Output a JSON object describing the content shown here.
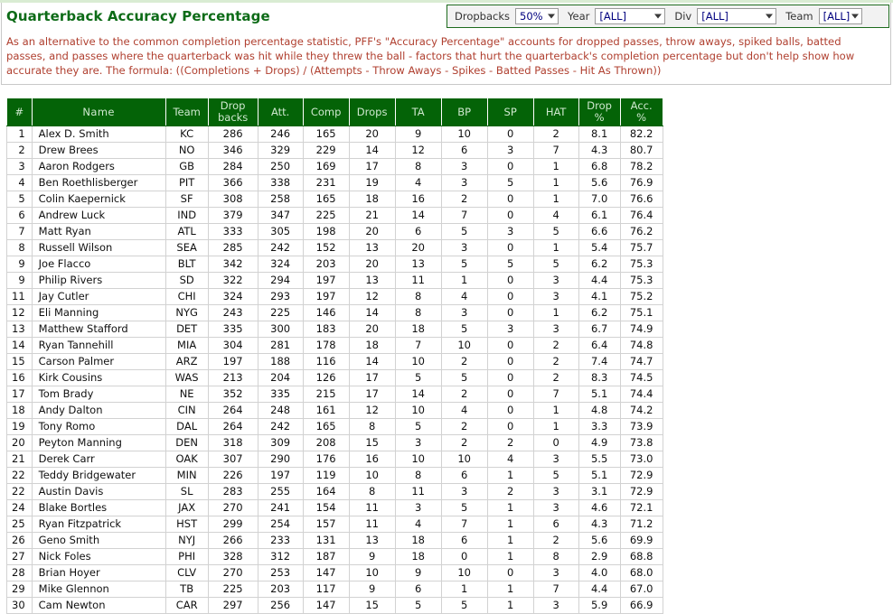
{
  "page": {
    "title": "Quarterback Accuracy Percentage",
    "description": "As an alternative to the common completion percentage statistic, PFF's \"Accuracy Percentage\" accounts for dropped passes, throw aways, spiked balls, batted passes, and passes where the quarterback was hit while they threw the ball - factors that hurt the quarterback's completion percentage but don't help show how accurate they are. The formula: ((Completions + Drops) / (Attempts - Throw Aways - Spikes - Batted Passes - Hit As Thrown))",
    "accent_green": "#046307",
    "title_green": "#0d6b17",
    "description_color": "#b04030"
  },
  "filters": [
    {
      "label": "Dropbacks",
      "name": "dropbacks",
      "value": "50%"
    },
    {
      "label": "Year",
      "name": "year",
      "value": "[ALL]"
    },
    {
      "label": "Div",
      "name": "div",
      "value": "[ALL]"
    },
    {
      "label": "Team",
      "name": "team",
      "value": "[ALL]"
    }
  ],
  "table": {
    "columns": [
      {
        "key": "rank",
        "label": "#"
      },
      {
        "key": "name",
        "label": "Name"
      },
      {
        "key": "team",
        "label": "Team"
      },
      {
        "key": "dropbacks",
        "label_line1": "Drop",
        "label_line2": "backs"
      },
      {
        "key": "att",
        "label": "Att."
      },
      {
        "key": "comp",
        "label": "Comp"
      },
      {
        "key": "drops",
        "label": "Drops"
      },
      {
        "key": "ta",
        "label": "TA"
      },
      {
        "key": "bp",
        "label": "BP"
      },
      {
        "key": "sp",
        "label": "SP"
      },
      {
        "key": "hat",
        "label": "HAT"
      },
      {
        "key": "droppct",
        "label": "Drop %"
      },
      {
        "key": "accpct",
        "label": "Acc. %"
      }
    ],
    "rows": [
      {
        "rank": "1",
        "name": "Alex D. Smith",
        "team": "KC",
        "dropbacks": "286",
        "att": "246",
        "comp": "165",
        "drops": "20",
        "ta": "9",
        "bp": "10",
        "sp": "0",
        "hat": "2",
        "droppct": "8.1",
        "accpct": "82.2"
      },
      {
        "rank": "2",
        "name": "Drew Brees",
        "team": "NO",
        "dropbacks": "346",
        "att": "329",
        "comp": "229",
        "drops": "14",
        "ta": "12",
        "bp": "6",
        "sp": "3",
        "hat": "7",
        "droppct": "4.3",
        "accpct": "80.7"
      },
      {
        "rank": "3",
        "name": "Aaron Rodgers",
        "team": "GB",
        "dropbacks": "284",
        "att": "250",
        "comp": "169",
        "drops": "17",
        "ta": "8",
        "bp": "3",
        "sp": "0",
        "hat": "1",
        "droppct": "6.8",
        "accpct": "78.2"
      },
      {
        "rank": "4",
        "name": "Ben Roethlisberger",
        "team": "PIT",
        "dropbacks": "366",
        "att": "338",
        "comp": "231",
        "drops": "19",
        "ta": "4",
        "bp": "3",
        "sp": "5",
        "hat": "1",
        "droppct": "5.6",
        "accpct": "76.9"
      },
      {
        "rank": "5",
        "name": "Colin Kaepernick",
        "team": "SF",
        "dropbacks": "308",
        "att": "258",
        "comp": "165",
        "drops": "18",
        "ta": "16",
        "bp": "2",
        "sp": "0",
        "hat": "1",
        "droppct": "7.0",
        "accpct": "76.6"
      },
      {
        "rank": "6",
        "name": "Andrew Luck",
        "team": "IND",
        "dropbacks": "379",
        "att": "347",
        "comp": "225",
        "drops": "21",
        "ta": "14",
        "bp": "7",
        "sp": "0",
        "hat": "4",
        "droppct": "6.1",
        "accpct": "76.4"
      },
      {
        "rank": "7",
        "name": "Matt Ryan",
        "team": "ATL",
        "dropbacks": "333",
        "att": "305",
        "comp": "198",
        "drops": "20",
        "ta": "6",
        "bp": "5",
        "sp": "3",
        "hat": "5",
        "droppct": "6.6",
        "accpct": "76.2"
      },
      {
        "rank": "8",
        "name": "Russell Wilson",
        "team": "SEA",
        "dropbacks": "285",
        "att": "242",
        "comp": "152",
        "drops": "13",
        "ta": "20",
        "bp": "3",
        "sp": "0",
        "hat": "1",
        "droppct": "5.4",
        "accpct": "75.7"
      },
      {
        "rank": "9",
        "name": "Joe Flacco",
        "team": "BLT",
        "dropbacks": "342",
        "att": "324",
        "comp": "203",
        "drops": "20",
        "ta": "13",
        "bp": "5",
        "sp": "5",
        "hat": "5",
        "droppct": "6.2",
        "accpct": "75.3"
      },
      {
        "rank": "9",
        "name": "Philip Rivers",
        "team": "SD",
        "dropbacks": "322",
        "att": "294",
        "comp": "197",
        "drops": "13",
        "ta": "11",
        "bp": "1",
        "sp": "0",
        "hat": "3",
        "droppct": "4.4",
        "accpct": "75.3"
      },
      {
        "rank": "11",
        "name": "Jay Cutler",
        "team": "CHI",
        "dropbacks": "324",
        "att": "293",
        "comp": "197",
        "drops": "12",
        "ta": "8",
        "bp": "4",
        "sp": "0",
        "hat": "3",
        "droppct": "4.1",
        "accpct": "75.2"
      },
      {
        "rank": "12",
        "name": "Eli Manning",
        "team": "NYG",
        "dropbacks": "243",
        "att": "225",
        "comp": "146",
        "drops": "14",
        "ta": "8",
        "bp": "3",
        "sp": "0",
        "hat": "1",
        "droppct": "6.2",
        "accpct": "75.1"
      },
      {
        "rank": "13",
        "name": "Matthew Stafford",
        "team": "DET",
        "dropbacks": "335",
        "att": "300",
        "comp": "183",
        "drops": "20",
        "ta": "18",
        "bp": "5",
        "sp": "3",
        "hat": "3",
        "droppct": "6.7",
        "accpct": "74.9"
      },
      {
        "rank": "14",
        "name": "Ryan Tannehill",
        "team": "MIA",
        "dropbacks": "304",
        "att": "281",
        "comp": "178",
        "drops": "18",
        "ta": "7",
        "bp": "10",
        "sp": "0",
        "hat": "2",
        "droppct": "6.4",
        "accpct": "74.8"
      },
      {
        "rank": "15",
        "name": "Carson Palmer",
        "team": "ARZ",
        "dropbacks": "197",
        "att": "188",
        "comp": "116",
        "drops": "14",
        "ta": "10",
        "bp": "2",
        "sp": "0",
        "hat": "2",
        "droppct": "7.4",
        "accpct": "74.7"
      },
      {
        "rank": "16",
        "name": "Kirk Cousins",
        "team": "WAS",
        "dropbacks": "213",
        "att": "204",
        "comp": "126",
        "drops": "17",
        "ta": "5",
        "bp": "5",
        "sp": "0",
        "hat": "2",
        "droppct": "8.3",
        "accpct": "74.5"
      },
      {
        "rank": "17",
        "name": "Tom Brady",
        "team": "NE",
        "dropbacks": "352",
        "att": "335",
        "comp": "215",
        "drops": "17",
        "ta": "14",
        "bp": "2",
        "sp": "0",
        "hat": "7",
        "droppct": "5.1",
        "accpct": "74.4"
      },
      {
        "rank": "18",
        "name": "Andy Dalton",
        "team": "CIN",
        "dropbacks": "264",
        "att": "248",
        "comp": "161",
        "drops": "12",
        "ta": "10",
        "bp": "4",
        "sp": "0",
        "hat": "1",
        "droppct": "4.8",
        "accpct": "74.2"
      },
      {
        "rank": "19",
        "name": "Tony Romo",
        "team": "DAL",
        "dropbacks": "264",
        "att": "242",
        "comp": "165",
        "drops": "8",
        "ta": "5",
        "bp": "2",
        "sp": "0",
        "hat": "1",
        "droppct": "3.3",
        "accpct": "73.9"
      },
      {
        "rank": "20",
        "name": "Peyton Manning",
        "team": "DEN",
        "dropbacks": "318",
        "att": "309",
        "comp": "208",
        "drops": "15",
        "ta": "3",
        "bp": "2",
        "sp": "2",
        "hat": "0",
        "droppct": "4.9",
        "accpct": "73.8"
      },
      {
        "rank": "21",
        "name": "Derek Carr",
        "team": "OAK",
        "dropbacks": "307",
        "att": "290",
        "comp": "176",
        "drops": "16",
        "ta": "10",
        "bp": "10",
        "sp": "4",
        "hat": "3",
        "droppct": "5.5",
        "accpct": "73.0"
      },
      {
        "rank": "22",
        "name": "Teddy Bridgewater",
        "team": "MIN",
        "dropbacks": "226",
        "att": "197",
        "comp": "119",
        "drops": "10",
        "ta": "8",
        "bp": "6",
        "sp": "1",
        "hat": "5",
        "droppct": "5.1",
        "accpct": "72.9"
      },
      {
        "rank": "22",
        "name": "Austin Davis",
        "team": "SL",
        "dropbacks": "283",
        "att": "255",
        "comp": "164",
        "drops": "8",
        "ta": "11",
        "bp": "3",
        "sp": "2",
        "hat": "3",
        "droppct": "3.1",
        "accpct": "72.9"
      },
      {
        "rank": "24",
        "name": "Blake Bortles",
        "team": "JAX",
        "dropbacks": "270",
        "att": "241",
        "comp": "154",
        "drops": "11",
        "ta": "3",
        "bp": "5",
        "sp": "1",
        "hat": "3",
        "droppct": "4.6",
        "accpct": "72.1"
      },
      {
        "rank": "25",
        "name": "Ryan Fitzpatrick",
        "team": "HST",
        "dropbacks": "299",
        "att": "254",
        "comp": "157",
        "drops": "11",
        "ta": "4",
        "bp": "7",
        "sp": "1",
        "hat": "6",
        "droppct": "4.3",
        "accpct": "71.2"
      },
      {
        "rank": "26",
        "name": "Geno Smith",
        "team": "NYJ",
        "dropbacks": "266",
        "att": "233",
        "comp": "131",
        "drops": "13",
        "ta": "18",
        "bp": "6",
        "sp": "1",
        "hat": "2",
        "droppct": "5.6",
        "accpct": "69.9"
      },
      {
        "rank": "27",
        "name": "Nick Foles",
        "team": "PHI",
        "dropbacks": "328",
        "att": "312",
        "comp": "187",
        "drops": "9",
        "ta": "18",
        "bp": "0",
        "sp": "1",
        "hat": "8",
        "droppct": "2.9",
        "accpct": "68.8"
      },
      {
        "rank": "28",
        "name": "Brian Hoyer",
        "team": "CLV",
        "dropbacks": "270",
        "att": "253",
        "comp": "147",
        "drops": "10",
        "ta": "9",
        "bp": "10",
        "sp": "0",
        "hat": "3",
        "droppct": "4.0",
        "accpct": "68.0"
      },
      {
        "rank": "29",
        "name": "Mike Glennon",
        "team": "TB",
        "dropbacks": "225",
        "att": "203",
        "comp": "117",
        "drops": "9",
        "ta": "6",
        "bp": "1",
        "sp": "1",
        "hat": "7",
        "droppct": "4.4",
        "accpct": "67.0"
      },
      {
        "rank": "30",
        "name": "Cam Newton",
        "team": "CAR",
        "dropbacks": "297",
        "att": "256",
        "comp": "147",
        "drops": "15",
        "ta": "5",
        "bp": "5",
        "sp": "1",
        "hat": "3",
        "droppct": "5.9",
        "accpct": "66.9"
      }
    ]
  }
}
